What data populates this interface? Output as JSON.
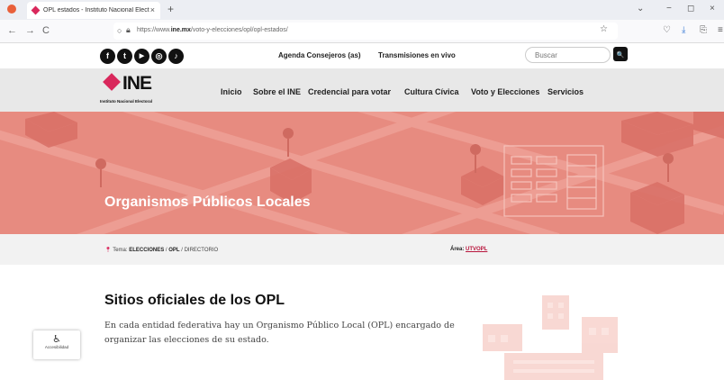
{
  "browser": {
    "tab_title": "OPL estados - Instituto Nacional Electoral",
    "tab_close": "×",
    "new_tab": "+",
    "back": "←",
    "forward": "→",
    "reload": "C",
    "url_prefix": "https://www.",
    "url_host": "ine.mx",
    "url_path": "/voto-y-elecciones/opl/opl-estados/",
    "win_min": "−",
    "win_max": "◻",
    "win_close": "×",
    "dropdown": "⌄"
  },
  "social_icons": [
    "f",
    "t",
    "▶",
    "◎",
    "♪"
  ],
  "topbar": {
    "agenda": "Agenda Consejeros (as)",
    "transmisiones": "Transmisiones en vivo",
    "search_placeholder": "Buscar",
    "search_icon": "🔍"
  },
  "logo": {
    "text": "INE",
    "subtitle": "Instituto Nacional Electoral"
  },
  "nav": [
    "Inicio",
    "Sobre el INE",
    "Credencial para votar",
    "Cultura Cívica",
    "Voto y Elecciones",
    "Servicios"
  ],
  "hero": {
    "title": "Organismos Públicos Locales"
  },
  "breadcrumb": {
    "prefix": "Tema:",
    "level1": "ELECCIONES",
    "sep": " / ",
    "level2": "OPL",
    "level3": "DIRECTORIO"
  },
  "area": {
    "label": "Área:",
    "value": "UTVOPL"
  },
  "main": {
    "title": "Sitios oficiales de los OPL",
    "description": "En cada entidad federativa hay un Organismo Público Local (OPL) encargado de organizar las elecciones de su estado."
  },
  "accessibility": {
    "label": "Accesibilidad"
  },
  "colors": {
    "accent": "#d9285c",
    "hero": "#e78b80"
  }
}
